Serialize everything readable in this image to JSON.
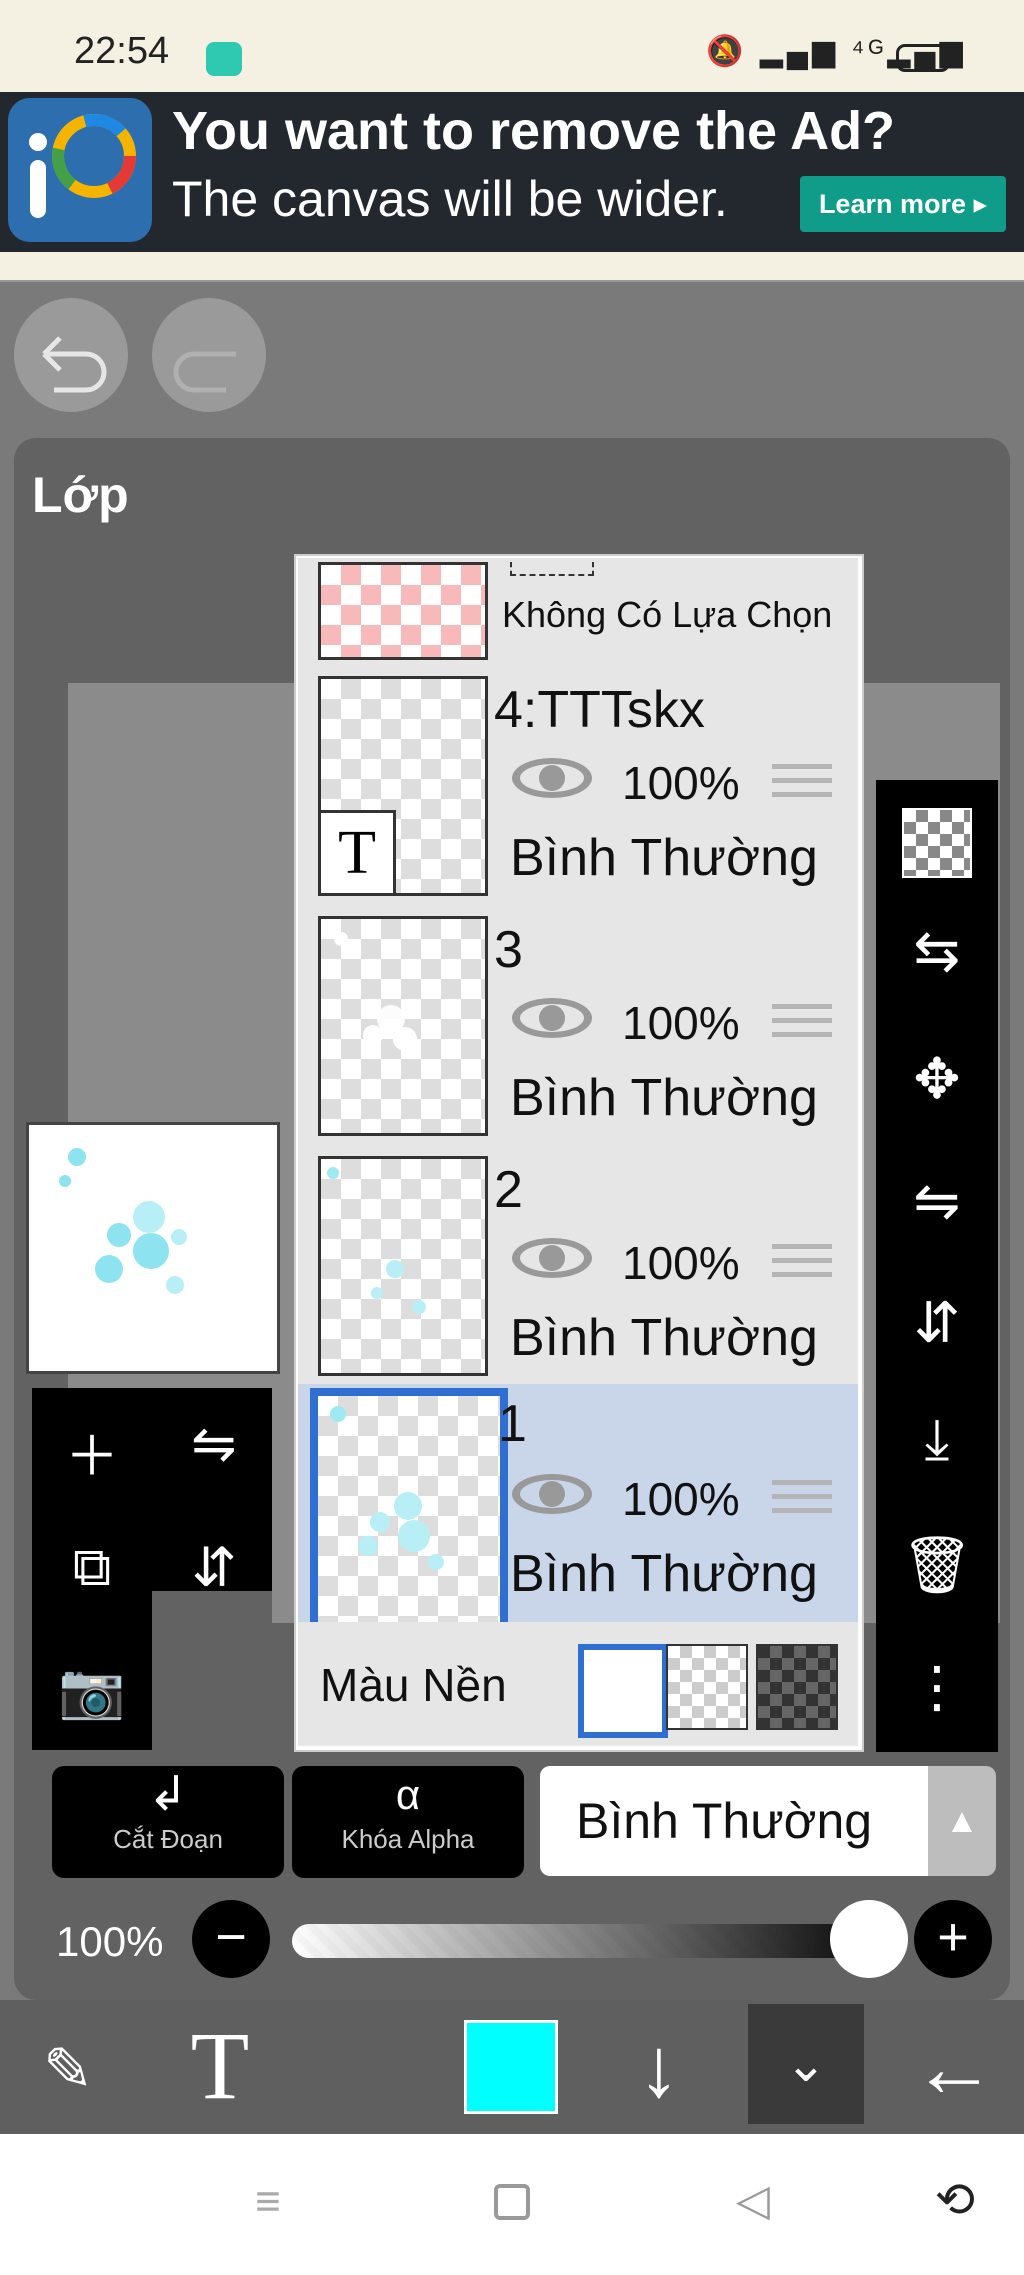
{
  "status_bar": {
    "time": "22:54",
    "icons_text": "🔕 ▂▄▆ ⁴ᴳ▂▄▆"
  },
  "ad": {
    "title": "You want to remove the Ad?",
    "subtitle": "The canvas will be wider.",
    "button": "Learn more ▸",
    "logo_text": "iP"
  },
  "undo_redo": {
    "undo_icon": "undo-icon",
    "redo_icon": "redo-icon"
  },
  "panel": {
    "title": "Lớp"
  },
  "layers": [
    {
      "name": "Không Có Lựa Chọn",
      "type": "selection"
    },
    {
      "name": "4:TTTskx",
      "opacity": "100%",
      "blend": "Bình Thường",
      "thumb_glyph": "T"
    },
    {
      "name": "3",
      "opacity": "100%",
      "blend": "Bình Thường"
    },
    {
      "name": "2",
      "opacity": "100%",
      "blend": "Bình Thường"
    },
    {
      "name": "1",
      "opacity": "100%",
      "blend": "Bình Thường",
      "selected": true
    }
  ],
  "background": {
    "label": "Màu Nền",
    "options": [
      "white",
      "checker",
      "dark-checker"
    ],
    "selected": "white"
  },
  "bottom_controls": {
    "clip_label": "Cắt Đoạn",
    "alpha_lock_label": "Khóa Alpha",
    "alpha_glyph": "α",
    "blend_mode": "Bình Thường",
    "opacity": "100%",
    "opacity_value": 1.0
  },
  "toolbar": {
    "current_color": "#00ffff",
    "text_tool_glyph": "T"
  },
  "colors": {
    "accent": "#2f6fd1",
    "ad_button": "#0f9d8a",
    "selected_layer": "#c9d6ea"
  }
}
